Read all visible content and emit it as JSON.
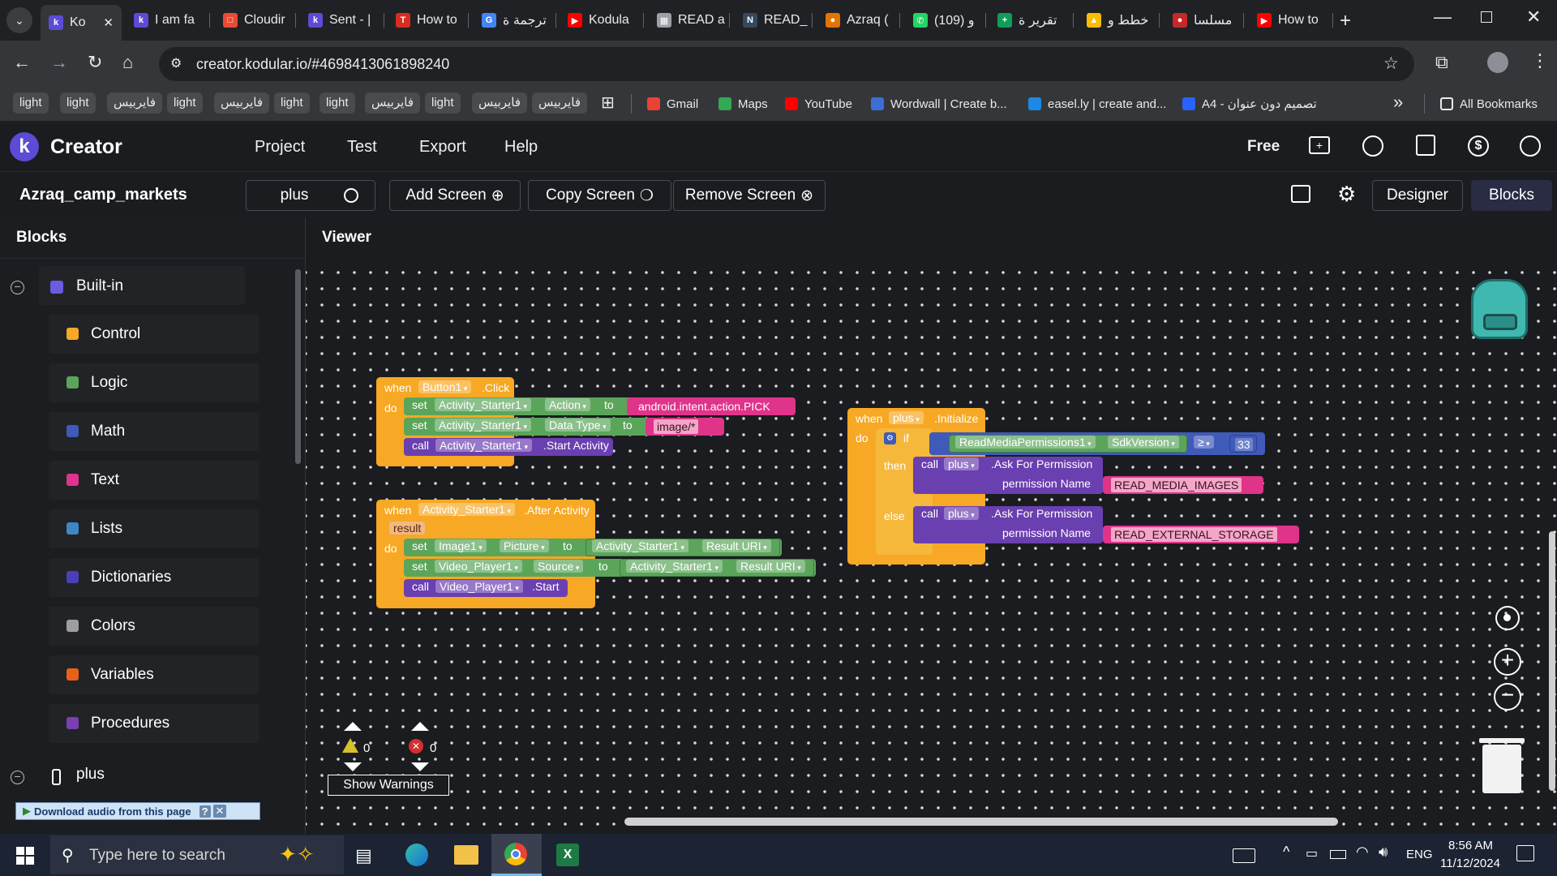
{
  "browser": {
    "tabs": [
      {
        "title": "Ko",
        "active": true,
        "color": "#5b4bd6",
        "letter": "k"
      },
      {
        "title": "I am fa",
        "color": "#5b4bd6",
        "letter": "k"
      },
      {
        "title": "Cloudir",
        "color": "#e94b35",
        "letter": "□"
      },
      {
        "title": "Sent - |",
        "color": "#5b4bd6",
        "letter": "k"
      },
      {
        "title": "How to",
        "color": "#d62d20",
        "letter": "T"
      },
      {
        "title": "ترجمة ة",
        "color": "#4285f4",
        "letter": "G"
      },
      {
        "title": "Kodula",
        "color": "#ff0000",
        "letter": "▶"
      },
      {
        "title": "READ a",
        "color": "#9aa0a6",
        "letter": "▦"
      },
      {
        "title": "READ_",
        "color": "#34495e",
        "letter": "N"
      },
      {
        "title": "Azraq (",
        "color": "#e37400",
        "letter": "●"
      },
      {
        "title": "(109) و",
        "color": "#25d366",
        "letter": "✆"
      },
      {
        "title": "تقرير ة",
        "color": "#0f9d58",
        "letter": "+"
      },
      {
        "title": "خطط و",
        "color": "#fbbc04",
        "letter": "▲"
      },
      {
        "title": "مسلسا",
        "color": "#c62828",
        "letter": "●"
      },
      {
        "title": "How to",
        "color": "#ff0000",
        "letter": "▶"
      }
    ],
    "url": "creator.kodular.io/#4698413061898240",
    "bookmarks_chips": [
      "light",
      "light",
      "فايربيس",
      "light",
      "فايربيس",
      "light",
      "light",
      "فايربيس",
      "light",
      "فايربيس",
      "فايربيس"
    ],
    "bookmarks": [
      {
        "label": "Gmail",
        "color": "#ea4335"
      },
      {
        "label": "Maps",
        "color": "#34a853"
      },
      {
        "label": "YouTube",
        "color": "#ff0000"
      },
      {
        "label": "Wordwall | Create b...",
        "color": "#3b6fd6"
      },
      {
        "label": "easel.ly | create and...",
        "color": "#1e88e5"
      },
      {
        "label": "A4 - تصميم دون عنوان",
        "color": "#2962ff"
      }
    ],
    "all_bookmarks": "All Bookmarks"
  },
  "app": {
    "brand": "Creator",
    "menu": [
      "Project",
      "Test",
      "Export",
      "Help"
    ],
    "plan": "Free",
    "project_name": "Azraq_camp_markets",
    "screen_select": "plus",
    "add_screen": "Add Screen",
    "copy_screen": "Copy Screen",
    "remove_screen": "Remove Screen",
    "designer": "Designer",
    "blocks_tab": "Blocks"
  },
  "sidebar": {
    "title": "Blocks",
    "builtin": "Built-in",
    "items": [
      {
        "label": "Control",
        "color": "#f7a824"
      },
      {
        "label": "Logic",
        "color": "#5ba55b"
      },
      {
        "label": "Math",
        "color": "#3f5ab8"
      },
      {
        "label": "Text",
        "color": "#e0338a"
      },
      {
        "label": "Lists",
        "color": "#3f87c4"
      },
      {
        "label": "Dictionaries",
        "color": "#4a3fb8"
      },
      {
        "label": "Colors",
        "color": "#9e9e9e"
      },
      {
        "label": "Variables",
        "color": "#e8611a"
      },
      {
        "label": "Procedures",
        "color": "#7a3fb0"
      }
    ],
    "screen": "plus",
    "download_audio": "Download audio from this page"
  },
  "viewer": {
    "title": "Viewer",
    "warnings_count": "0",
    "errors_count": "0",
    "show_warnings": "Show Warnings"
  },
  "blocks": {
    "b1": {
      "when": "when",
      "comp": "Button1",
      "event": ".Click",
      "do": "do",
      "rows": [
        {
          "kw": "set",
          "comp": "Activity_Starter1",
          "prop": "Action",
          "to": "to",
          "val": "android.intent.action.PICK"
        },
        {
          "kw": "set",
          "comp": "Activity_Starter1",
          "prop": "Data Type",
          "to": "to",
          "val": "image/*"
        },
        {
          "kw": "call",
          "comp": "Activity_Starter1",
          "method": ".Start Activity"
        }
      ]
    },
    "b2": {
      "when": "when",
      "comp": "Activity_Starter1",
      "event": ".After Activity",
      "param": "result",
      "do": "do",
      "rows": [
        {
          "kw": "set",
          "comp": "Image1",
          "prop": "Picture",
          "to": "to",
          "src": "Activity_Starter1",
          "sprop": "Result URI"
        },
        {
          "kw": "set",
          "comp": "Video_Player1",
          "prop": "Source",
          "to": "to",
          "src": "Activity_Starter1",
          "sprop": "Result URI"
        },
        {
          "kw": "call",
          "comp": "Video_Player1",
          "method": ".Start"
        }
      ]
    },
    "b3": {
      "when": "when",
      "comp": "plus",
      "event": ".Initialize",
      "do": "do",
      "if": "if",
      "cond_comp": "ReadMediaPermissions1",
      "cond_prop": "SdkVersion",
      "op": "≥",
      "num": "33",
      "then": "then",
      "else": "else",
      "call": "call",
      "call_comp": "plus",
      "call_method": ".Ask For Permission",
      "perm_label": "permission Name",
      "perm_then": "READ_MEDIA_IMAGES",
      "perm_else": "READ_EXTERNAL_STORAGE"
    }
  },
  "taskbar": {
    "search": "Type here to search",
    "lang": "ENG",
    "time": "8:56 AM",
    "date": "11/12/2024"
  }
}
